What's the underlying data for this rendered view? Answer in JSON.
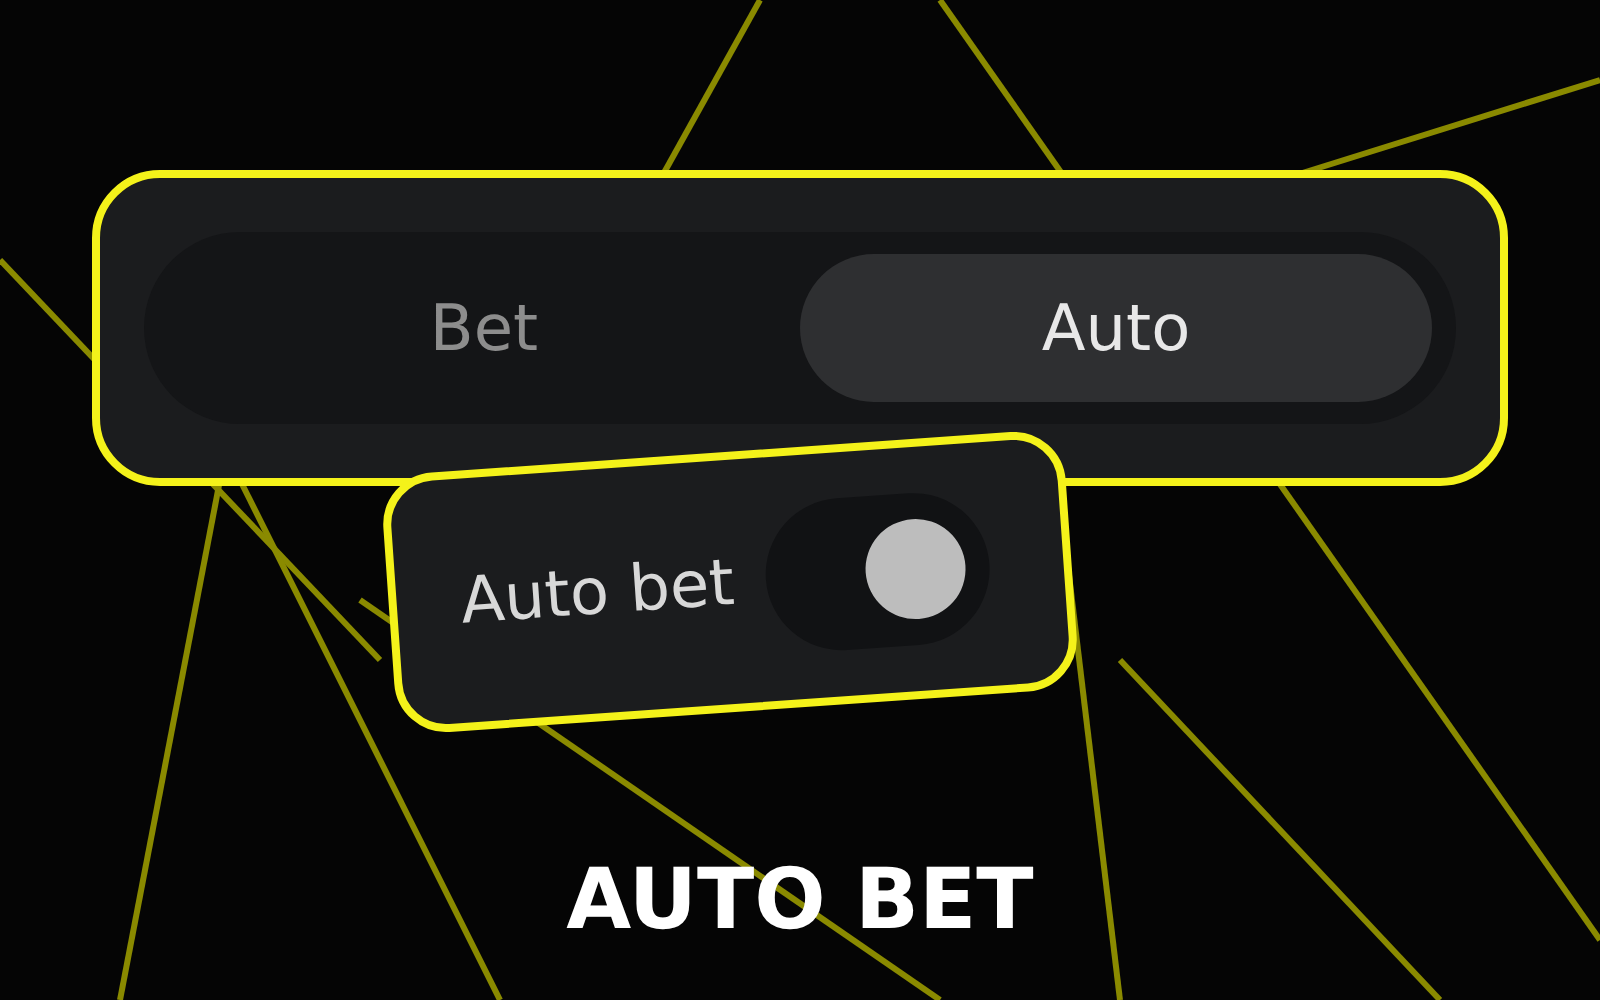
{
  "mode_tabs": [
    {
      "label": "Bet",
      "selected": false
    },
    {
      "label": "Auto",
      "selected": true
    }
  ],
  "auto_bet": {
    "label": "Auto bet",
    "on": true
  },
  "caption": "AUTO BET"
}
